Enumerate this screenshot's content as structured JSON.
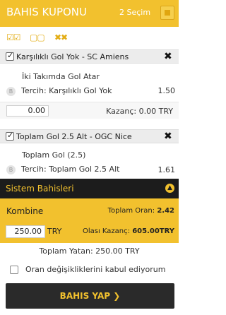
{
  "header": {
    "title": "BAHIS KUPONU",
    "count": "2 Seçim"
  },
  "tools": {
    "icons": [
      "check-all-icon",
      "uncheck-all-icon",
      "delete-all-icon"
    ],
    "accent": "#f2c12e"
  },
  "bets": [
    {
      "match": "Karşılıklı Gol Yok - SC Amiens",
      "market": "İki Takımda Gol Atar",
      "pick": "Tercih: Karşılıklı Gol Yok",
      "odd": "1.50",
      "stake": "0.00",
      "win": "Kazanç: 0.00 TRY",
      "checked": true
    },
    {
      "match": "Toplam Gol 2.5 Alt - OGC Nice",
      "market": "Toplam Gol (2.5)",
      "pick": "Tercih: Toplam Gol 2.5 Alt",
      "odd": "1.61",
      "checked": true
    }
  ],
  "sistem": {
    "label": "Sistem Bahisleri"
  },
  "kombine": {
    "label": "Kombine",
    "total_odds_label": "Toplam Oran:",
    "total_odds": "2.42",
    "amount": "250.00",
    "currency": "TRY",
    "max_win_label": "Olası Kazanç:",
    "max_win": "605.00TRY"
  },
  "summary": {
    "total_stake": "Toplam Yatan: 250.00 TRY"
  },
  "accept": {
    "label": "Oran değişikliklerini kabul ediyorum"
  },
  "submit": {
    "label": "BAHIS YAP",
    "arrow": "❯"
  }
}
